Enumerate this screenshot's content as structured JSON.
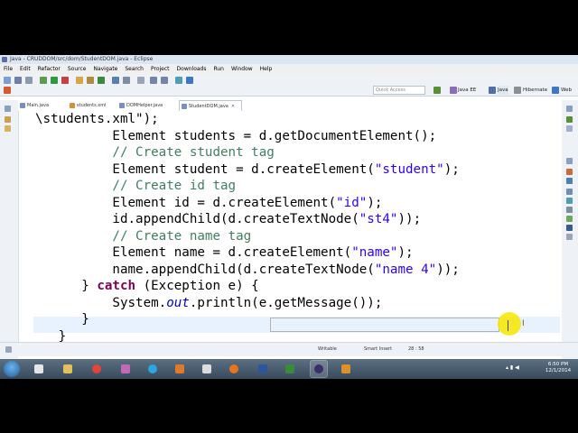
{
  "window": {
    "title": "Java - CRUDDOM/src/dom/StudentDOM.java - Eclipse"
  },
  "menu": [
    "File",
    "Edit",
    "Refactor",
    "Source",
    "Navigate",
    "Search",
    "Project",
    "Downloads",
    "Run",
    "Window",
    "Help"
  ],
  "toolbar": {
    "quick_access_placeholder": "Quick Access",
    "perspectives": [
      "Java EE",
      "Java",
      "Hibernate",
      "Web"
    ]
  },
  "tabs": [
    {
      "label": "Main.java",
      "active": false
    },
    {
      "label": "students.xml",
      "active": false
    },
    {
      "label": "DOMHelper.java",
      "active": false
    },
    {
      "label": "StudentDOM.java",
      "active": true
    }
  ],
  "code": [
    {
      "indent": "",
      "parts": [
        [
          "n",
          "\\students.xml\");"
        ]
      ]
    },
    {
      "indent": "          ",
      "parts": [
        [
          "n",
          "Element students = d.getDocumentElement();"
        ]
      ]
    },
    {
      "indent": "          ",
      "parts": [
        [
          "cm",
          "// Create student tag"
        ]
      ]
    },
    {
      "indent": "          ",
      "parts": [
        [
          "n",
          "Element student = d.createElement("
        ],
        [
          "st",
          "\"student\""
        ],
        [
          "n",
          ");"
        ]
      ]
    },
    {
      "indent": "          ",
      "parts": [
        [
          "cm",
          "// Create id tag"
        ]
      ]
    },
    {
      "indent": "          ",
      "parts": [
        [
          "n",
          "Element id = d.createElement("
        ],
        [
          "st",
          "\"id\""
        ],
        [
          "n",
          ");"
        ]
      ]
    },
    {
      "indent": "          ",
      "parts": [
        [
          "n",
          "id.appendChild(d.createTextNode("
        ],
        [
          "st",
          "\"st4\""
        ],
        [
          "n",
          "));"
        ]
      ]
    },
    {
      "indent": "          ",
      "parts": [
        [
          "cm",
          "// Create name tag"
        ]
      ]
    },
    {
      "indent": "          ",
      "parts": [
        [
          "n",
          "Element name = d.createElement("
        ],
        [
          "st",
          "\"name\""
        ],
        [
          "n",
          ");"
        ]
      ]
    },
    {
      "indent": "          ",
      "parts": [
        [
          "n",
          "name.appendChild(d.createTextNode("
        ],
        [
          "st",
          "\"name 4\""
        ],
        [
          "n",
          "));"
        ]
      ]
    },
    {
      "indent": "      ",
      "parts": [
        [
          "n",
          "} "
        ],
        [
          "kw",
          "catch"
        ],
        [
          "n",
          " (Exception e) {"
        ]
      ]
    },
    {
      "indent": "          ",
      "parts": [
        [
          "n",
          "System."
        ],
        [
          "it",
          "out"
        ],
        [
          "n",
          ".println(e.getMessage());"
        ]
      ]
    },
    {
      "indent": "      ",
      "parts": [
        [
          "n",
          "}"
        ]
      ]
    },
    {
      "indent": "   ",
      "parts": [
        [
          "n",
          "}"
        ]
      ]
    }
  ],
  "status": {
    "writable": "Writable",
    "insert_mode": "Smart Insert",
    "position": "28 : 58"
  },
  "taskbar": {
    "time": "6:50 PM",
    "date": "12/1/2014"
  },
  "colors": {
    "keyword": "#7f0055",
    "comment": "#3f7f5f",
    "string": "#2a00ff",
    "field": "#0000c0",
    "cursor_highlight": "#f7e700"
  }
}
